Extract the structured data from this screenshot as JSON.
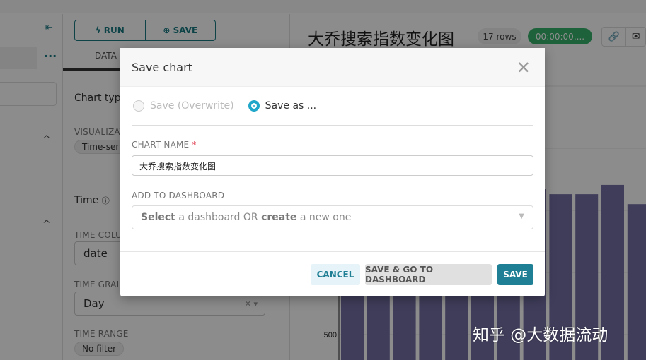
{
  "toolbar": {
    "run_label": "RUN",
    "save_label": "SAVE"
  },
  "panel": {
    "tab_data": "DATA",
    "chart_type_label": "Chart type",
    "visualization_label": "VISUALIZAT",
    "visualization_value": "Time-seri",
    "time_section": "Time",
    "time_column_label": "TIME COLU",
    "time_column_value": "date",
    "time_grain_label": "TIME GRAIN",
    "time_grain_value": "Day",
    "time_range_label": "TIME RANGE",
    "time_range_value": "No filter"
  },
  "header": {
    "title": "大乔搜索指数变化图",
    "rows_badge": "17 rows",
    "timer_badge": "00:00:00....",
    "timer_color": "#2e9a5a"
  },
  "chart_data": {
    "type": "bar",
    "y_tick_labels": [
      "500"
    ],
    "values": [
      1600,
      1600,
      1600,
      1600,
      1600,
      1600,
      1600,
      1670,
      1630,
      1630,
      1705,
      1550
    ],
    "bar_color": "#736fa4"
  },
  "modal": {
    "title": "Save chart",
    "radio_overwrite": "Save (Overwrite)",
    "radio_save_as": "Save as ...",
    "selected": "save_as",
    "chart_name_label": "CHART NAME",
    "required_mark": "*",
    "chart_name_value": "大乔搜索指数变化图",
    "dashboard_label": "ADD TO DASHBOARD",
    "dashboard_placeholder_1": "Select",
    "dashboard_placeholder_2": " a dashboard OR ",
    "dashboard_placeholder_3": "create",
    "dashboard_placeholder_4": " a new one",
    "cancel": "CANCEL",
    "save_go": "SAVE & GO TO DASHBOARD",
    "save": "SAVE",
    "accent": "#1f7f94"
  },
  "watermark": "知乎 @大数据流动"
}
